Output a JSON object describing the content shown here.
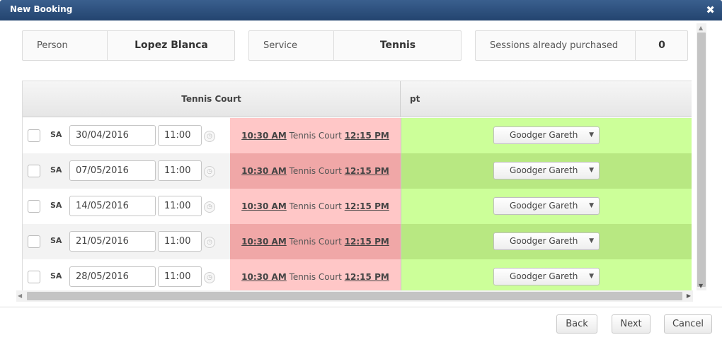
{
  "dialog": {
    "title": "New Booking",
    "close_symbol": "✖"
  },
  "info": {
    "person_label": "Person",
    "person_value": "Lopez Blanca",
    "service_label": "Service",
    "service_value": "Tennis",
    "sessions_label": "Sessions already purchased",
    "sessions_value": "0"
  },
  "grid": {
    "columns": [
      "Tennis Court",
      "pt"
    ],
    "rows": [
      {
        "day": "SA",
        "date": "30/04/2016",
        "time": "11:00",
        "start": "10:30 AM",
        "resource": "Tennis Court",
        "end": "12:15 PM",
        "staff": "Goodger Gareth"
      },
      {
        "day": "SA",
        "date": "07/05/2016",
        "time": "11:00",
        "start": "10:30 AM",
        "resource": "Tennis Court",
        "end": "12:15 PM",
        "staff": "Goodger Gareth"
      },
      {
        "day": "SA",
        "date": "14/05/2016",
        "time": "11:00",
        "start": "10:30 AM",
        "resource": "Tennis Court",
        "end": "12:15 PM",
        "staff": "Goodger Gareth"
      },
      {
        "day": "SA",
        "date": "21/05/2016",
        "time": "11:00",
        "start": "10:30 AM",
        "resource": "Tennis Court",
        "end": "12:15 PM",
        "staff": "Goodger Gareth"
      },
      {
        "day": "SA",
        "date": "28/05/2016",
        "time": "11:00",
        "start": "10:30 AM",
        "resource": "Tennis Court",
        "end": "12:15 PM",
        "staff": "Goodger Gareth"
      }
    ]
  },
  "buttons": {
    "back": "Back",
    "next": "Next",
    "cancel": "Cancel"
  },
  "colors": {
    "titlebar": "#2c4f7c",
    "court_slot": "#ffc7c7",
    "court_slot_alt": "#f0a7a7",
    "staff_available": "#ccff99",
    "staff_available_alt": "#b8e882"
  },
  "icons": {
    "close": "close-icon",
    "time_picker": "clock-icon",
    "dropdown": "chevron-down-icon"
  }
}
